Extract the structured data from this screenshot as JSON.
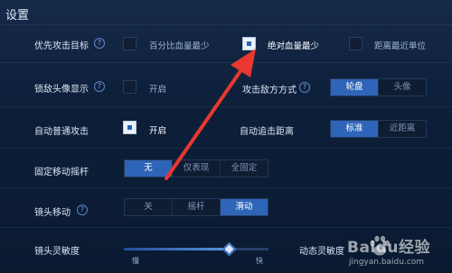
{
  "title": "设置",
  "rows": {
    "priority": {
      "label": "优先攻击目标",
      "options": [
        "百分比血量最少",
        "绝对血量最少",
        "距离最近单位"
      ],
      "selected_index": 1
    },
    "lock_avatar": {
      "label": "锁敌头像显示",
      "option": "开启",
      "checked": false
    },
    "attack_mode": {
      "label": "攻击敌方方式",
      "options": [
        "轮盘",
        "头像"
      ],
      "active": "轮盘"
    },
    "auto_attack": {
      "label": "自动普通攻击",
      "option": "开启",
      "checked": true
    },
    "auto_chase": {
      "label": "自动追击距离",
      "options": [
        "标准",
        "近距离"
      ],
      "active": "标准"
    },
    "joystick": {
      "label": "固定移动摇杆",
      "options": [
        "无",
        "仅表现",
        "全固定"
      ],
      "active": "无"
    },
    "camera_move": {
      "label": "镜头移动",
      "options": [
        "关",
        "摇杆",
        "滑动"
      ],
      "active": "滑动"
    },
    "camera_sens": {
      "label": "镜头灵敏度",
      "min_label": "慢",
      "max_label": "快",
      "value_fraction": 0.73
    },
    "dynamic_sens": {
      "label": "动态灵敏度"
    }
  },
  "watermark": {
    "brand": "Baidu经验",
    "url": "jingyan.baidu.com"
  },
  "colors": {
    "accent": "#2f65b8",
    "arrow": "#e8382f",
    "background": "#0d1f39"
  }
}
